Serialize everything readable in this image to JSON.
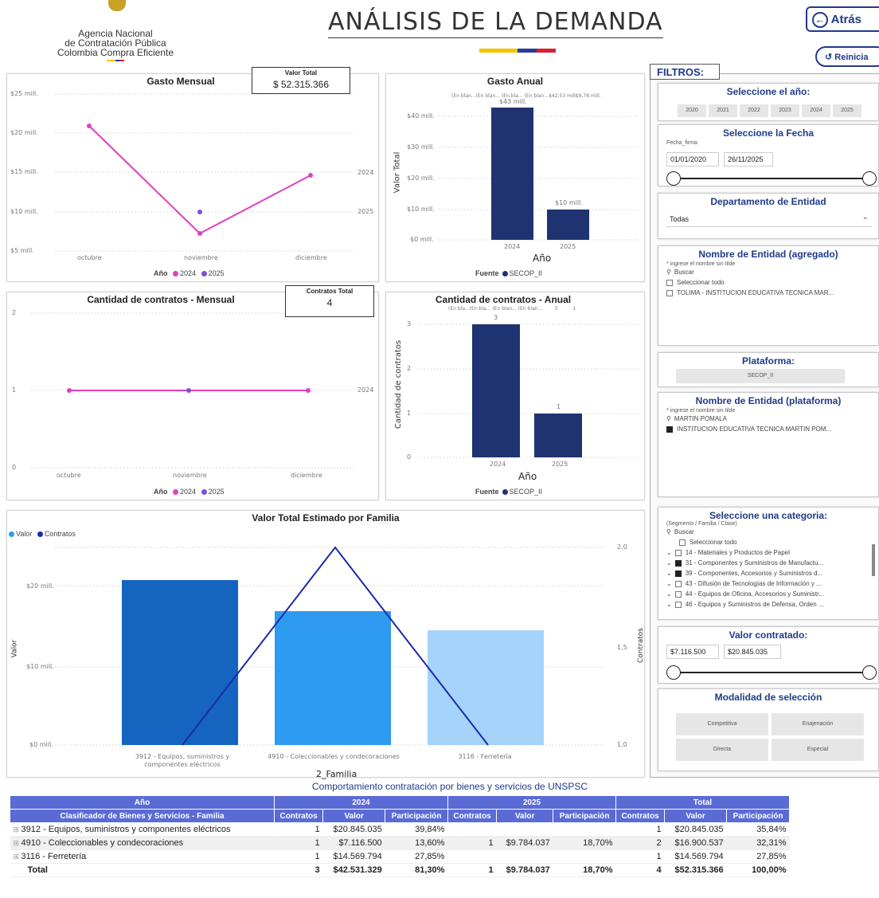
{
  "header": {
    "title": "ANÁLISIS DE LA DEMANDA",
    "agency_line1": "Agencia Nacional",
    "agency_line2": "de Contratación Pública",
    "agency_line3": "Colombia Compra Eficiente",
    "back_label": "Atrás",
    "reset_label": "Reinicia",
    "colors": {
      "yellow": "#f5c400",
      "blue": "#2b3b9c",
      "red": "#d6202f"
    }
  },
  "gasto_mensual": {
    "title": "Gasto Mensual",
    "card_label": "Valor Total",
    "card_value": "$ 52.315.366",
    "y_ticks": [
      "$25 mill.",
      "$20 mill.",
      "$15 mill.",
      "$10 mill.",
      "$5 mill."
    ],
    "x_ticks": [
      "octubre",
      "noviembre",
      "diciembre"
    ],
    "right_labels": [
      "2024",
      "2025"
    ],
    "legend_title": "Año",
    "legend": [
      "2024",
      "2025"
    ],
    "colors": [
      "#e040c0",
      "#7b4fd6"
    ]
  },
  "gasto_anual": {
    "title": "Gasto Anual",
    "top_labels": "(En blan...(En blan... (En bla... (En blan...$42,53 mill$9,78 mill.",
    "bar_labels": [
      "$43 mill.",
      "$10 mill."
    ],
    "y_ticks": [
      "$40 mill.",
      "$30 mill.",
      "$20 mill.",
      "$10 mill.",
      "$0 mill."
    ],
    "x_ticks": [
      "2024",
      "2025"
    ],
    "ylabel": "Valor Total",
    "xlabel": "Año",
    "legend_title": "Fuente",
    "legend": [
      "SECOP_II"
    ],
    "color": "#1f3370"
  },
  "cantidad_mensual": {
    "title": "Cantidad de contratos - Mensual",
    "card_label": "Contratos Total",
    "card_value": "4",
    "y_ticks": [
      "2",
      "1",
      "0"
    ],
    "x_ticks": [
      "octubre",
      "noviembre",
      "diciembre"
    ],
    "right_labels": [
      "2024"
    ],
    "legend_title": "Año",
    "legend": [
      "2024",
      "2025"
    ]
  },
  "cantidad_anual": {
    "title": "Cantidad de contratos - Anual",
    "top_labels": "(En bla...(En bla... (En blan... (En blan...        3          1",
    "bar_labels": [
      "3",
      "1"
    ],
    "y_ticks": [
      "3",
      "2",
      "1",
      "0"
    ],
    "x_ticks": [
      "2024",
      "2025"
    ],
    "ylabel": "Cantidad de contratos",
    "xlabel": "Año",
    "legend_title": "Fuente",
    "legend": [
      "SECOP_II"
    ]
  },
  "familia": {
    "title": "Valor Total Estimado por Familia",
    "legend": [
      "Valor",
      "Contratos"
    ],
    "y_ticks": [
      "$20 mill.",
      "$10 mill.",
      "$0 mill."
    ],
    "y2_ticks": [
      "2,0",
      "1,5",
      "1,0"
    ],
    "ylabel": "Valor",
    "y2label": "Contratos",
    "xlabel": "2_Familia",
    "categories": [
      "3912 - Equipos, suministros y componentes eléctricos",
      "4910 - Coleccionables y condecoraciones",
      "3116 - Ferretería"
    ],
    "colors": [
      "#1565c0",
      "#2f9bf0",
      "#a6d3fb"
    ],
    "line_color": "#1a2aa8"
  },
  "chart_data": [
    {
      "type": "line",
      "title": "Gasto Mensual",
      "categories": [
        "octubre",
        "noviembre",
        "diciembre"
      ],
      "series": [
        {
          "name": "2024",
          "values": [
            20.845035,
            7.1165,
            14.569794
          ]
        },
        {
          "name": "2025",
          "values": [
            null,
            9.784037,
            null
          ]
        }
      ],
      "ylabel": "",
      "ylim": [
        5,
        25
      ]
    },
    {
      "type": "bar",
      "title": "Gasto Anual",
      "categories": [
        "2024",
        "2025"
      ],
      "values": [
        42.531329,
        9.784037
      ],
      "xlabel": "Año",
      "ylabel": "Valor Total",
      "ylim": [
        0,
        45
      ]
    },
    {
      "type": "line",
      "title": "Cantidad de contratos - Mensual",
      "categories": [
        "octubre",
        "noviembre",
        "diciembre"
      ],
      "series": [
        {
          "name": "2024",
          "values": [
            1,
            1,
            1
          ]
        }
      ],
      "ylim": [
        0,
        2
      ]
    },
    {
      "type": "bar",
      "title": "Cantidad de contratos - Anual",
      "categories": [
        "2024",
        "2025"
      ],
      "values": [
        3,
        1
      ],
      "xlabel": "Año",
      "ylabel": "Cantidad de contratos",
      "ylim": [
        0,
        3
      ]
    },
    {
      "type": "bar",
      "title": "Valor Total Estimado por Familia",
      "categories": [
        "3912 - Equipos, suministros y componentes eléctricos",
        "4910 - Coleccionables y condecoraciones",
        "3116 - Ferretería"
      ],
      "series": [
        {
          "name": "Valor",
          "values": [
            20.845035,
            16.900537,
            14.569794
          ]
        },
        {
          "name": "Contratos",
          "values": [
            1,
            2,
            1
          ]
        }
      ],
      "xlabel": "2_Familia",
      "ylabel": "Valor",
      "y2label": "Contratos",
      "ylim": [
        0,
        23
      ],
      "y2lim": [
        1,
        2
      ]
    }
  ],
  "filtros": {
    "label": "FILTROS:",
    "anio": {
      "title": "Seleccione el año:",
      "options": [
        "2020",
        "2021",
        "2022",
        "2023",
        "2024",
        "2025"
      ]
    },
    "fecha": {
      "title": "Seleccione la Fecha",
      "field": "Fecha_firma",
      "from": "01/01/2020",
      "to": "26/11/2025"
    },
    "departamento": {
      "title": "Departamento de Entidad",
      "value": "Todas"
    },
    "entidad_agregado": {
      "title": "Nombre de Entidad (agregado)",
      "hint": "* ingrese el nombre sin tilde",
      "search": "Buscar",
      "select_all": "Seleccionar todo",
      "item": "TOLIMA - INSTITUCION EDUCATIVA TECNICA MAR..."
    },
    "plataforma": {
      "title": "Plataforma:",
      "value": "SECOP_II"
    },
    "entidad_plataforma": {
      "title": "Nombre de Entidad (plataforma)",
      "hint": "* ingrese el nombre sin tilde",
      "search": "MARTIN POMALA",
      "item": "INSTITUCION EDUCATIVA TECNICA MARTIN POM..."
    },
    "categoria": {
      "title": "Seleccione una categoria:",
      "hint": "(Segmento / Familia / Clase)",
      "search": "Buscar",
      "select_all": "Seleccionar todo",
      "items": [
        "14 - Materiales y Productos de Papel",
        "31 - Componentes y Suministros de Manufactu...",
        "39 - Componentes, Accesorios y Suministros d...",
        "43 - Difusión de Tecnologías de Información y ...",
        "44 - Equipos de Oficina, Accesorios y Suministr...",
        "46 - Equipos y Suministros de Defensa, Orden ..."
      ],
      "checked": [
        false,
        true,
        true,
        false,
        false,
        false
      ]
    },
    "valor": {
      "title": "Valor contratado:",
      "from": "$7.116.500",
      "to": "$20.845.035"
    },
    "modalidad": {
      "title": "Modalidad de selección",
      "options": [
        "Competitiva",
        "Enajenación",
        "Directa",
        "Especial"
      ]
    }
  },
  "tabla": {
    "title": "Comportamiento contratación por bienes y servicios de UNSPSC",
    "h_anio": "Año",
    "h_2024": "2024",
    "h_2025": "2025",
    "h_total": "Total",
    "h_clasif": "Clasificador de Bienes y Servicios - Familia",
    "h_contratos": "Contratos",
    "h_valor": "Valor",
    "h_part": "Participación",
    "rows": [
      {
        "name": "3912 - Equipos, suministros y componentes eléctricos",
        "c24": "1",
        "v24": "$20.845.035",
        "p24": "39,84%",
        "c25": "",
        "v25": "",
        "p25": "",
        "ct": "1",
        "vt": "$20.845.035",
        "pt": "35,84%"
      },
      {
        "name": "4910 - Coleccionables y condecoraciones",
        "c24": "1",
        "v24": "$7.116.500",
        "p24": "13,60%",
        "c25": "1",
        "v25": "$9.784.037",
        "p25": "18,70%",
        "ct": "2",
        "vt": "$16.900.537",
        "pt": "32,31%"
      },
      {
        "name": "3116 - Ferretería",
        "c24": "1",
        "v24": "$14.569.794",
        "p24": "27,85%",
        "c25": "",
        "v25": "",
        "p25": "",
        "ct": "1",
        "vt": "$14.569.794",
        "pt": "27,85%"
      }
    ],
    "total": {
      "name": "Total",
      "c24": "3",
      "v24": "$42.531.329",
      "p24": "81,30%",
      "c25": "1",
      "v25": "$9.784.037",
      "p25": "18,70%",
      "ct": "4",
      "vt": "$52.315.366",
      "pt": "100,00%"
    }
  }
}
